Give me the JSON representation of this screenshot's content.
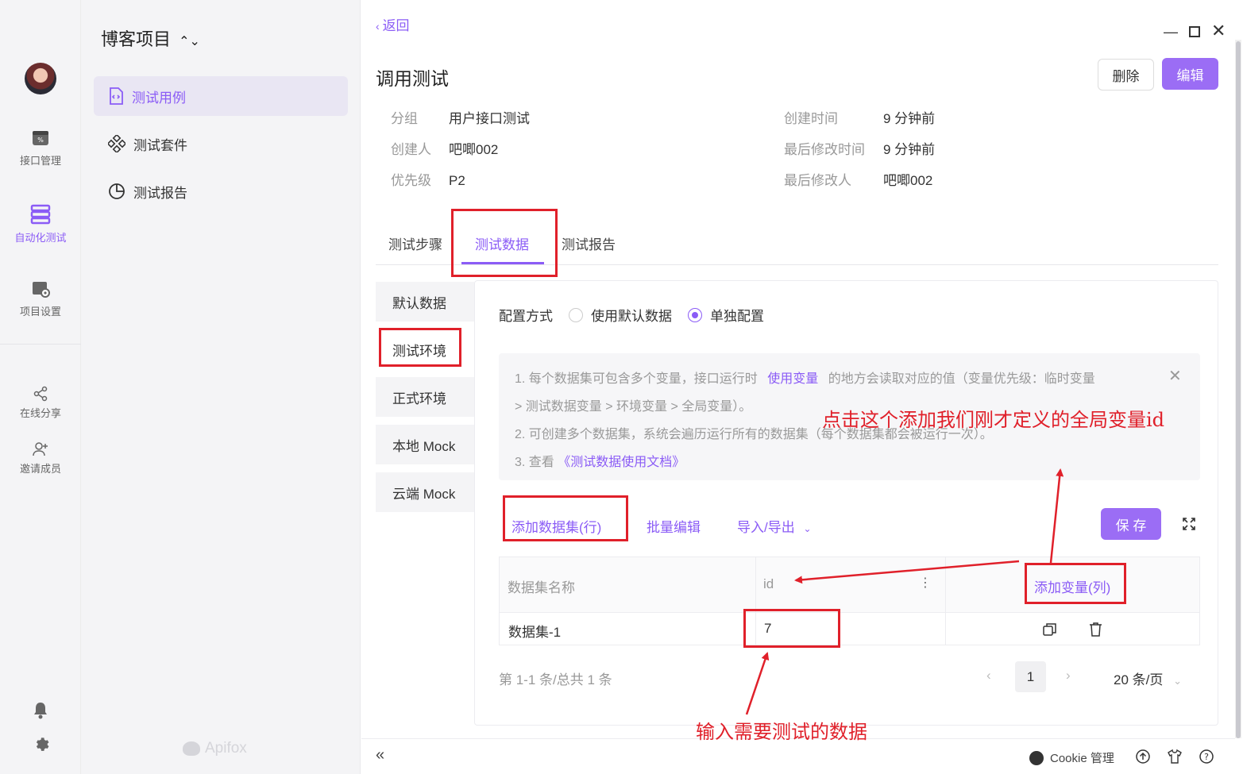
{
  "rail": {
    "items": [
      {
        "label": "接口管理",
        "icon": "api-icon"
      },
      {
        "label": "自动化测试",
        "icon": "automation-icon"
      },
      {
        "label": "项目设置",
        "icon": "settings-project-icon"
      },
      {
        "label": "在线分享",
        "icon": "share-icon"
      },
      {
        "label": "邀请成员",
        "icon": "invite-icon"
      }
    ]
  },
  "subnav": {
    "project_title": "博客项目",
    "items": [
      {
        "label": "测试用例"
      },
      {
        "label": "测试套件"
      },
      {
        "label": "测试报告"
      }
    ],
    "brand": "Apifox"
  },
  "header": {
    "back": "返回",
    "title": "调用测试",
    "delete_label": "删除",
    "edit_label": "编辑"
  },
  "meta": {
    "group_k": "分组",
    "group_v": "用户接口测试",
    "creator_k": "创建人",
    "creator_v": "吧唧002",
    "priority_k": "优先级",
    "priority_v": "P2",
    "created_k": "创建时间",
    "created_v": "9 分钟前",
    "modified_k": "最后修改时间",
    "modified_v": "9 分钟前",
    "modifier_k": "最后修改人",
    "modifier_v": "吧唧002"
  },
  "tabs": [
    {
      "label": "测试步骤"
    },
    {
      "label": "测试数据"
    },
    {
      "label": "测试报告"
    }
  ],
  "envs": [
    {
      "label": "默认数据"
    },
    {
      "label": "测试环境"
    },
    {
      "label": "正式环境"
    },
    {
      "label": "本地 Mock"
    },
    {
      "label": "云端 Mock"
    }
  ],
  "config": {
    "label": "配置方式",
    "opt_default": "使用默认数据",
    "opt_single": "单独配置"
  },
  "tips": {
    "l1a": "1. 每个数据集可包含多个变量，接口运行时",
    "l1link": "使用变量",
    "l1b": "的地方会读取对应的值（变量优先级：临时变量",
    "l2": "> 测试数据变量 > 环境变量 > 全局变量）。",
    "l3": "2. 可创建多个数据集，系统会遍历运行所有的数据集（每个数据集都会被运行一次）。",
    "l4a": "3. 查看",
    "l4link": "《测试数据使用文档》"
  },
  "actions": {
    "add_row": "添加数据集(行)",
    "batch_edit": "批量编辑",
    "import_export": "导入/导出",
    "save": "保 存"
  },
  "table": {
    "col_name": "数据集名称",
    "col_id": "id",
    "add_col": "添加变量(列)",
    "rows": [
      {
        "name": "数据集-1",
        "id": "7"
      }
    ]
  },
  "pager": {
    "summary": "第 1-1 条/总共 1 条",
    "page": "1",
    "per_page": "20 条/页"
  },
  "footer": {
    "cookie": "Cookie 管理"
  },
  "annotations": {
    "note_top": "点击这个添加我们刚才定义的全局变量id",
    "note_bottom": "输入需要测试的数据"
  },
  "colors": {
    "accent": "#8b5cf6",
    "annotation": "#e0202a"
  }
}
